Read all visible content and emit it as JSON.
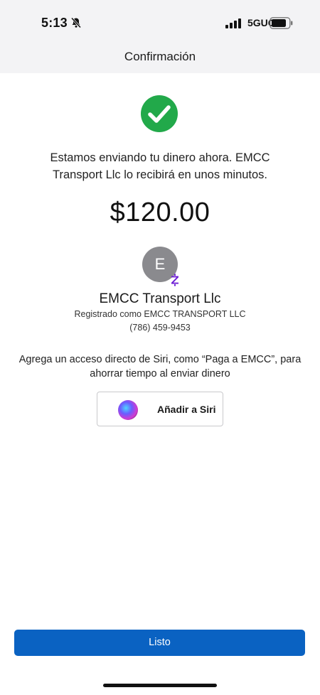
{
  "status_bar": {
    "time": "5:13",
    "network": "5GUC",
    "icons": [
      "bell-off-icon",
      "signal-icon",
      "battery-icon"
    ]
  },
  "header": {
    "title": "Confirmación"
  },
  "confirmation": {
    "icon": "check-circle-icon",
    "message": "Estamos enviando tu dinero ahora. EMCC Transport Llc lo recibirá en unos minutos.",
    "amount": "$120.00"
  },
  "recipient": {
    "avatar_initial": "E",
    "name": "EMCC Transport Llc",
    "registered_as": "Registrado como EMCC TRANSPORT LLC",
    "phone": "(786) 459-9453",
    "badge_icon": "zelle-icon"
  },
  "siri": {
    "hint": "Agrega un acceso directo de Siri, como “Paga a EMCC”, para ahorrar tiempo al enviar dinero",
    "button_label": "Añadir a Siri"
  },
  "footer": {
    "done_label": "Listo"
  },
  "colors": {
    "accent": "#0a62c2",
    "success": "#22a94a",
    "zelle": "#6d1ed4"
  }
}
